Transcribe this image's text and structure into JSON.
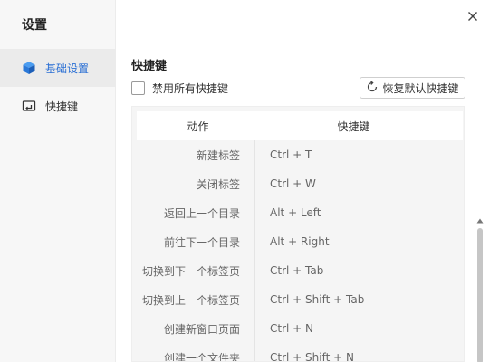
{
  "sidebar": {
    "title": "设置",
    "items": [
      {
        "label": "基础设置",
        "icon": "cube-icon",
        "active": true
      },
      {
        "label": "快捷键",
        "icon": "keyboard-icon",
        "active": false
      }
    ]
  },
  "main": {
    "section_title": "快捷键",
    "disable_all_label": "禁用所有快捷键",
    "disable_all_checked": false,
    "restore_button_label": "恢复默认快捷键",
    "table": {
      "columns": [
        "动作",
        "快捷键"
      ],
      "rows": [
        {
          "action": "新建标签",
          "shortcut": "Ctrl + T"
        },
        {
          "action": "关闭标签",
          "shortcut": "Ctrl + W"
        },
        {
          "action": "返回上一个目录",
          "shortcut": "Alt + Left"
        },
        {
          "action": "前往下一个目录",
          "shortcut": "Alt + Right"
        },
        {
          "action": "切换到下一个标签页",
          "shortcut": "Ctrl + Tab"
        },
        {
          "action": "切换到上一个标签页",
          "shortcut": "Ctrl + Shift + Tab"
        },
        {
          "action": "创建新窗口页面",
          "shortcut": "Ctrl + N"
        },
        {
          "action": "创建一个文件夹",
          "shortcut": "Ctrl + Shift + N"
        }
      ]
    }
  },
  "colors": {
    "accent": "#2a6fd4",
    "sidebar_bg": "#f7f7f7",
    "table_bg": "#f5f5f5"
  }
}
